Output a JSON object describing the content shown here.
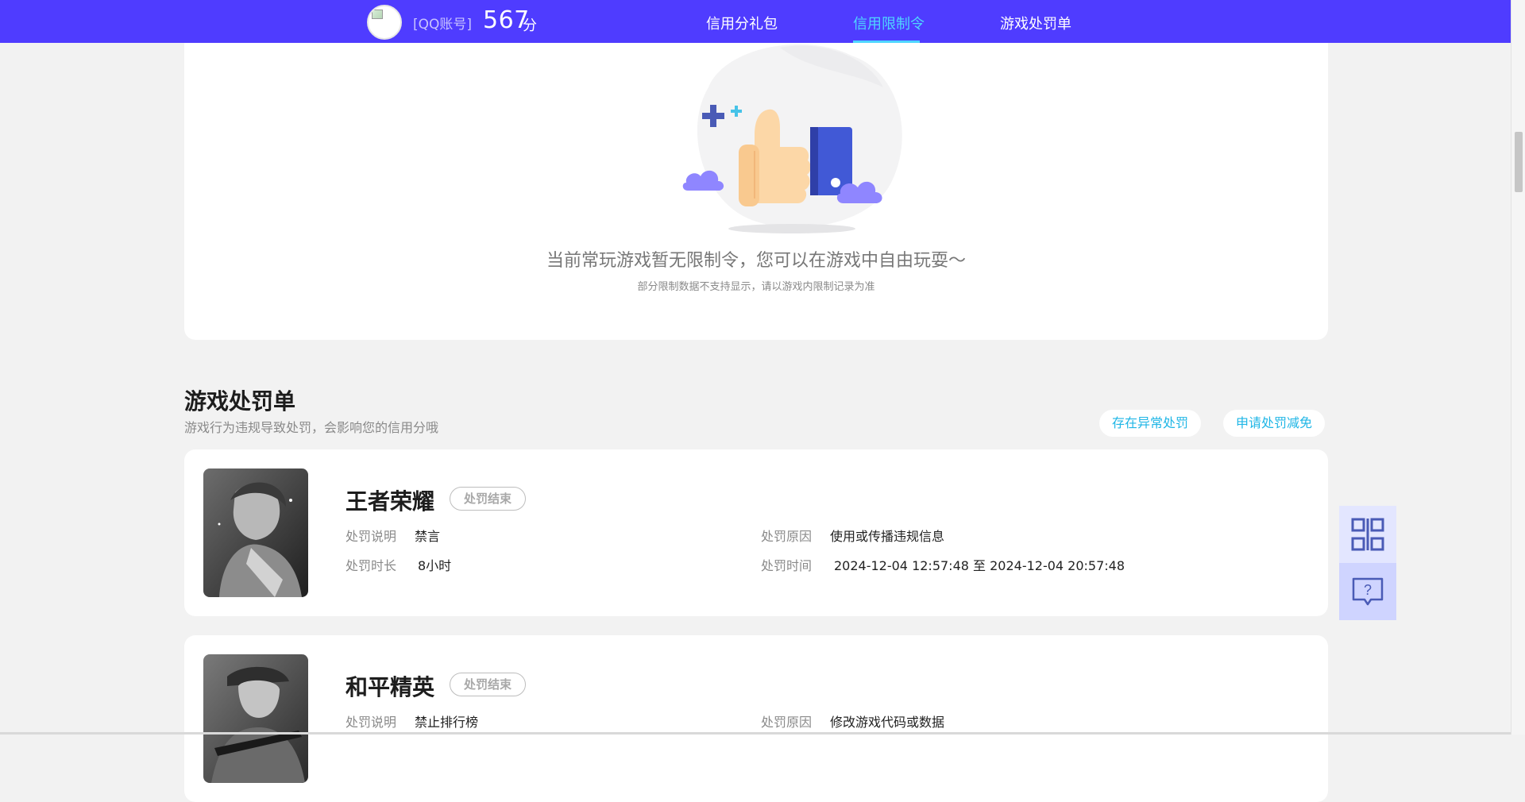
{
  "header": {
    "account_label": "[QQ账号]",
    "score": "567",
    "score_unit": "分",
    "nav": [
      {
        "label": "信用分礼包",
        "active": false
      },
      {
        "label": "信用限制令",
        "active": true
      },
      {
        "label": "游戏处罚单",
        "active": false
      }
    ]
  },
  "restriction": {
    "empty_title": "当前常玩游戏暂无限制令，您可以在游戏中自由玩耍～",
    "empty_subtitle": "部分限制数据不支持显示，请以游戏内限制记录为准"
  },
  "penalty_section": {
    "title": "游戏处罚单",
    "description": "游戏行为违规导致处罚，会影响您的信用分哦",
    "report_button": "存在异常处罚",
    "appeal_button": "申请处罚减免",
    "field_labels": {
      "description": "处罚说明",
      "duration": "处罚时长",
      "reason": "处罚原因",
      "time": "处罚时间"
    },
    "records": [
      {
        "game": "王者荣耀",
        "status": "处罚结束",
        "description": "禁言",
        "duration": "8小时",
        "reason": "使用或传播违规信息",
        "time": "2024-12-04 12:57:48 至 2024-12-04 20:57:48"
      },
      {
        "game": "和平精英",
        "status": "处罚结束",
        "description": "禁止排行榜",
        "reason": "修改游戏代码或数据"
      }
    ]
  },
  "floating_tools": [
    {
      "icon": "qr-code-icon"
    },
    {
      "icon": "help-chat-icon"
    }
  ],
  "colors": {
    "nav_bg": "#4f3cff",
    "nav_active": "#4fd6ff",
    "link_blue": "#1fb6e6",
    "page_bg": "#f2f2f2"
  }
}
